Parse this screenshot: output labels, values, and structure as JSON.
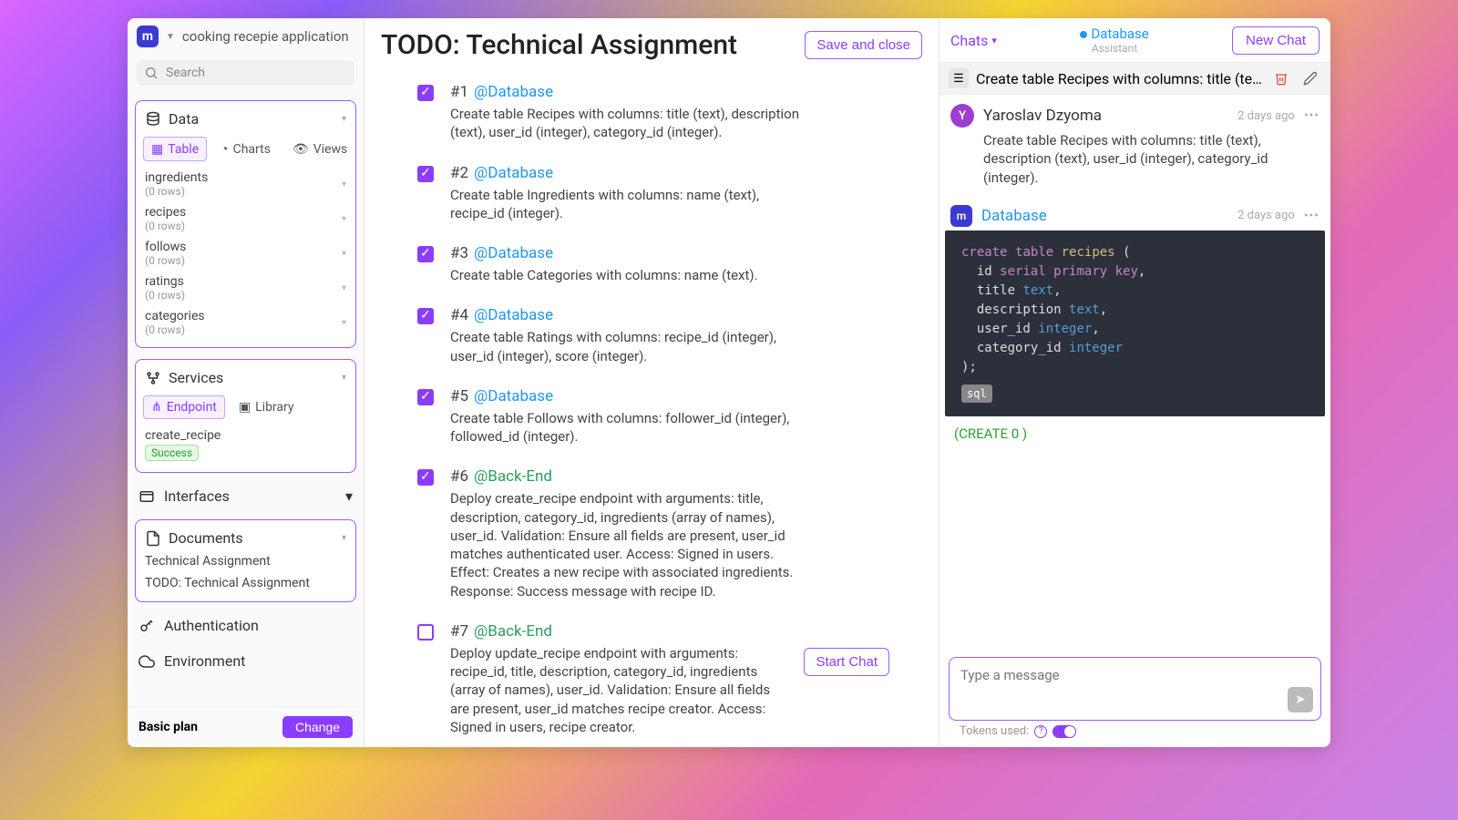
{
  "app": {
    "name": "cooking recepie application",
    "logo_letter": "m"
  },
  "search": {
    "placeholder": "Search"
  },
  "data_panel": {
    "title": "Data",
    "tabs": {
      "table": "Table",
      "charts": "Charts",
      "views": "Views"
    },
    "tables": [
      {
        "name": "ingredients",
        "rows": "(0 rows)"
      },
      {
        "name": "recipes",
        "rows": "(0 rows)"
      },
      {
        "name": "follows",
        "rows": "(0 rows)"
      },
      {
        "name": "ratings",
        "rows": "(0 rows)"
      },
      {
        "name": "categories",
        "rows": "(0 rows)"
      }
    ]
  },
  "services_panel": {
    "title": "Services",
    "tabs": {
      "endpoint": "Endpoint",
      "library": "Library"
    },
    "item": {
      "name": "create_recipe",
      "status": "Success"
    }
  },
  "nav": {
    "interfaces": "Interfaces",
    "documents": "Documents",
    "doc_items": [
      "Technical Assignment",
      "TODO: Technical Assignment"
    ],
    "authentication": "Authentication",
    "environment": "Environment"
  },
  "plan": {
    "label": "Basic plan",
    "button": "Change"
  },
  "main": {
    "title": "TODO: Technical Assignment",
    "save": "Save and close",
    "start_chat": "Start Chat",
    "todos": [
      {
        "num": "#1",
        "tag": "@Database",
        "tag_type": "db",
        "checked": true,
        "desc": "Create table Recipes with columns: title (text), description (text), user_id (integer), category_id (integer)."
      },
      {
        "num": "#2",
        "tag": "@Database",
        "tag_type": "db",
        "checked": true,
        "desc": "Create table Ingredients with columns: name (text), recipe_id (integer)."
      },
      {
        "num": "#3",
        "tag": "@Database",
        "tag_type": "db",
        "checked": true,
        "desc": "Create table Categories with columns: name (text)."
      },
      {
        "num": "#4",
        "tag": "@Database",
        "tag_type": "db",
        "checked": true,
        "desc": "Create table Ratings with columns: recipe_id (integer), user_id (integer), score (integer)."
      },
      {
        "num": "#5",
        "tag": "@Database",
        "tag_type": "db",
        "checked": true,
        "desc": "Create table Follows with columns: follower_id (integer), followed_id (integer)."
      },
      {
        "num": "#6",
        "tag": "@Back-End",
        "tag_type": "be",
        "checked": true,
        "desc": "Deploy create_recipe endpoint with arguments: title, description, category_id, ingredients (array of names), user_id. Validation: Ensure all fields are present, user_id matches authenticated user. Access: Signed in users. Effect: Creates a new recipe with associated ingredients. Response: Success message with recipe ID."
      },
      {
        "num": "#7",
        "tag": "@Back-End",
        "tag_type": "be",
        "checked": false,
        "desc": "Deploy update_recipe endpoint with arguments: recipe_id, title, description, category_id, ingredients (array of names), user_id. Validation: Ensure all fields are present, user_id matches recipe creator. Access: Signed in users, recipe creator."
      }
    ]
  },
  "chat": {
    "chats_label": "Chats",
    "active": {
      "name": "Database",
      "sub": "Assistant"
    },
    "new_chat": "New Chat",
    "thread_title": "Create table Recipes with columns: title (tex…",
    "messages": {
      "user": {
        "initial": "Y",
        "name": "Yaroslav Dzyoma",
        "time": "2 days ago",
        "body": "Create table Recipes with columns: title (text), description (text), user_id (integer), category_id (integer)."
      },
      "assistant": {
        "initial": "m",
        "name": "Database",
        "time": "2 days ago"
      }
    },
    "code_lines": [
      "create table recipes (",
      "  id serial primary key,",
      "  title text,",
      "  description text,",
      "  user_id integer,",
      "  category_id integer",
      ");"
    ],
    "sql_pill": "sql",
    "result": "(CREATE 0 )",
    "input_placeholder": "Type a message",
    "tokens": "Tokens used:"
  }
}
